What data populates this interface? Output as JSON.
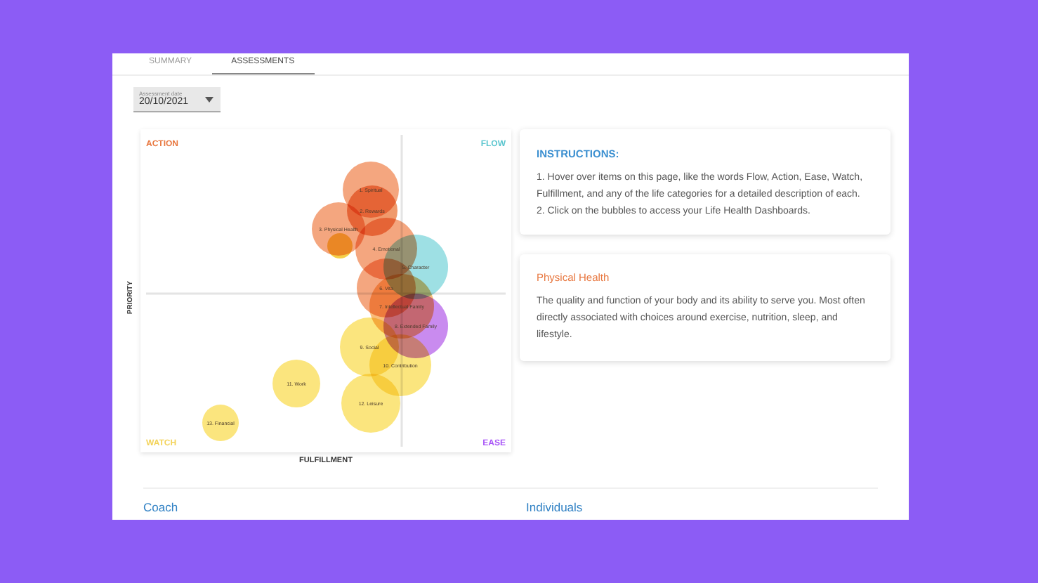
{
  "tabs": [
    {
      "label": "SUMMARY",
      "selected": false
    },
    {
      "label": "ASSESSMENTS",
      "selected": true
    }
  ],
  "date_select": {
    "label": "Assessment date",
    "value": "20/10/2021"
  },
  "chart": {
    "quadrants": [
      "ACTION",
      "FLOW",
      "WATCH",
      "EASE"
    ],
    "y_axis": "PRIORITY",
    "x_axis": "FULFILLMENT",
    "bubbles": [
      {
        "label": "1. Spiritual",
        "color": "#f4a67f"
      },
      {
        "label": "2. Rewards",
        "color": "#f09a6c"
      },
      {
        "label": "3. Physical Health",
        "color": "#f4a67f"
      },
      {
        "label": "4. Emotional",
        "color": "#f4a67f"
      },
      {
        "label": "5. Character",
        "color": "#9ee0e4"
      },
      {
        "label": "6. Vita",
        "color": "#f4a67f"
      },
      {
        "label": "7. Intellectual Family",
        "color": "#f8bd7a"
      },
      {
        "label": "8. Extended Family",
        "color": "#c98bef"
      },
      {
        "label": "9. Social",
        "color": "#fbe57e"
      },
      {
        "label": "10. Contribution",
        "color": "#fbe57e"
      },
      {
        "label": "11. Work",
        "color": "#fbe57e"
      },
      {
        "label": "12. Leisure",
        "color": "#fbe57e"
      },
      {
        "label": "13. Financial",
        "color": "#fbe57e"
      }
    ]
  },
  "instructions": {
    "title": "INSTRUCTIONS:",
    "lines": [
      "1. Hover over items on this page, like the words Flow, Action, Ease, Watch, Fulfillment, and any of the life categories for a detailed description of each.",
      "2. Click on the bubbles to access your Life Health Dashboards."
    ]
  },
  "detail": {
    "title": "Physical Health",
    "text": "The quality and function of your body and its ability to serve you. Most often directly associated with choices around exercise, nutrition, sleep, and lifestyle."
  },
  "sections": [
    "Coach",
    "Individuals"
  ]
}
